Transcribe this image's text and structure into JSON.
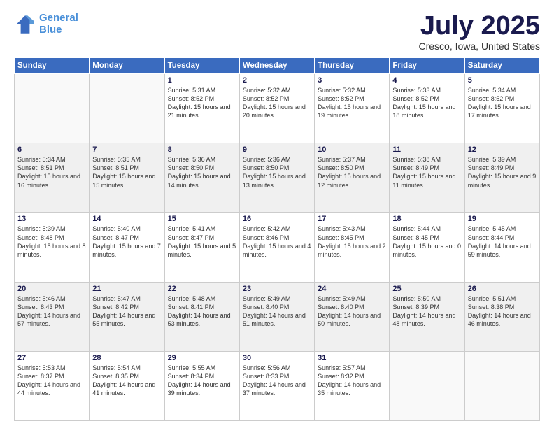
{
  "header": {
    "logo_line1": "General",
    "logo_line2": "Blue",
    "month_title": "July 2025",
    "location": "Cresco, Iowa, United States"
  },
  "weekdays": [
    "Sunday",
    "Monday",
    "Tuesday",
    "Wednesday",
    "Thursday",
    "Friday",
    "Saturday"
  ],
  "weeks": [
    [
      {
        "day": "",
        "info": ""
      },
      {
        "day": "",
        "info": ""
      },
      {
        "day": "1",
        "info": "Sunrise: 5:31 AM\nSunset: 8:52 PM\nDaylight: 15 hours and 21 minutes."
      },
      {
        "day": "2",
        "info": "Sunrise: 5:32 AM\nSunset: 8:52 PM\nDaylight: 15 hours and 20 minutes."
      },
      {
        "day": "3",
        "info": "Sunrise: 5:32 AM\nSunset: 8:52 PM\nDaylight: 15 hours and 19 minutes."
      },
      {
        "day": "4",
        "info": "Sunrise: 5:33 AM\nSunset: 8:52 PM\nDaylight: 15 hours and 18 minutes."
      },
      {
        "day": "5",
        "info": "Sunrise: 5:34 AM\nSunset: 8:52 PM\nDaylight: 15 hours and 17 minutes."
      }
    ],
    [
      {
        "day": "6",
        "info": "Sunrise: 5:34 AM\nSunset: 8:51 PM\nDaylight: 15 hours and 16 minutes."
      },
      {
        "day": "7",
        "info": "Sunrise: 5:35 AM\nSunset: 8:51 PM\nDaylight: 15 hours and 15 minutes."
      },
      {
        "day": "8",
        "info": "Sunrise: 5:36 AM\nSunset: 8:50 PM\nDaylight: 15 hours and 14 minutes."
      },
      {
        "day": "9",
        "info": "Sunrise: 5:36 AM\nSunset: 8:50 PM\nDaylight: 15 hours and 13 minutes."
      },
      {
        "day": "10",
        "info": "Sunrise: 5:37 AM\nSunset: 8:50 PM\nDaylight: 15 hours and 12 minutes."
      },
      {
        "day": "11",
        "info": "Sunrise: 5:38 AM\nSunset: 8:49 PM\nDaylight: 15 hours and 11 minutes."
      },
      {
        "day": "12",
        "info": "Sunrise: 5:39 AM\nSunset: 8:49 PM\nDaylight: 15 hours and 9 minutes."
      }
    ],
    [
      {
        "day": "13",
        "info": "Sunrise: 5:39 AM\nSunset: 8:48 PM\nDaylight: 15 hours and 8 minutes."
      },
      {
        "day": "14",
        "info": "Sunrise: 5:40 AM\nSunset: 8:47 PM\nDaylight: 15 hours and 7 minutes."
      },
      {
        "day": "15",
        "info": "Sunrise: 5:41 AM\nSunset: 8:47 PM\nDaylight: 15 hours and 5 minutes."
      },
      {
        "day": "16",
        "info": "Sunrise: 5:42 AM\nSunset: 8:46 PM\nDaylight: 15 hours and 4 minutes."
      },
      {
        "day": "17",
        "info": "Sunrise: 5:43 AM\nSunset: 8:45 PM\nDaylight: 15 hours and 2 minutes."
      },
      {
        "day": "18",
        "info": "Sunrise: 5:44 AM\nSunset: 8:45 PM\nDaylight: 15 hours and 0 minutes."
      },
      {
        "day": "19",
        "info": "Sunrise: 5:45 AM\nSunset: 8:44 PM\nDaylight: 14 hours and 59 minutes."
      }
    ],
    [
      {
        "day": "20",
        "info": "Sunrise: 5:46 AM\nSunset: 8:43 PM\nDaylight: 14 hours and 57 minutes."
      },
      {
        "day": "21",
        "info": "Sunrise: 5:47 AM\nSunset: 8:42 PM\nDaylight: 14 hours and 55 minutes."
      },
      {
        "day": "22",
        "info": "Sunrise: 5:48 AM\nSunset: 8:41 PM\nDaylight: 14 hours and 53 minutes."
      },
      {
        "day": "23",
        "info": "Sunrise: 5:49 AM\nSunset: 8:40 PM\nDaylight: 14 hours and 51 minutes."
      },
      {
        "day": "24",
        "info": "Sunrise: 5:49 AM\nSunset: 8:40 PM\nDaylight: 14 hours and 50 minutes."
      },
      {
        "day": "25",
        "info": "Sunrise: 5:50 AM\nSunset: 8:39 PM\nDaylight: 14 hours and 48 minutes."
      },
      {
        "day": "26",
        "info": "Sunrise: 5:51 AM\nSunset: 8:38 PM\nDaylight: 14 hours and 46 minutes."
      }
    ],
    [
      {
        "day": "27",
        "info": "Sunrise: 5:53 AM\nSunset: 8:37 PM\nDaylight: 14 hours and 44 minutes."
      },
      {
        "day": "28",
        "info": "Sunrise: 5:54 AM\nSunset: 8:35 PM\nDaylight: 14 hours and 41 minutes."
      },
      {
        "day": "29",
        "info": "Sunrise: 5:55 AM\nSunset: 8:34 PM\nDaylight: 14 hours and 39 minutes."
      },
      {
        "day": "30",
        "info": "Sunrise: 5:56 AM\nSunset: 8:33 PM\nDaylight: 14 hours and 37 minutes."
      },
      {
        "day": "31",
        "info": "Sunrise: 5:57 AM\nSunset: 8:32 PM\nDaylight: 14 hours and 35 minutes."
      },
      {
        "day": "",
        "info": ""
      },
      {
        "day": "",
        "info": ""
      }
    ]
  ]
}
